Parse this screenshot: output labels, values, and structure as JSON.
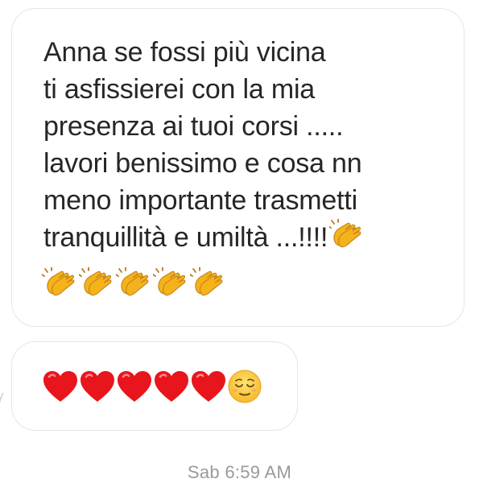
{
  "conversation": {
    "message_1": {
      "lines": [
        "Anna se fossi più vicina",
        "ti asfissierei con la mia",
        "presenza ai tuoi corsi .....",
        "lavori benissimo e cosa nn",
        "meno importante trasmetti",
        "tranquillità e umiltà ...!!!!"
      ],
      "trailing_emoji": [
        "clapping-hands-icon",
        "clapping-hands-icon",
        "clapping-hands-icon",
        "clapping-hands-icon",
        "clapping-hands-icon",
        "clapping-hands-icon"
      ]
    },
    "message_2": {
      "emoji": [
        "red-heart-icon",
        "red-heart-icon",
        "red-heart-icon",
        "red-heart-icon",
        "red-heart-icon",
        "relieved-face-icon"
      ]
    },
    "timestamp": "Sab 6:59 AM"
  },
  "colors": {
    "text": "#262626",
    "bubble_border": "#e6e6e6",
    "timestamp": "#9a9a9a",
    "heart": "#e8161c",
    "clap": "#f5b31b"
  }
}
